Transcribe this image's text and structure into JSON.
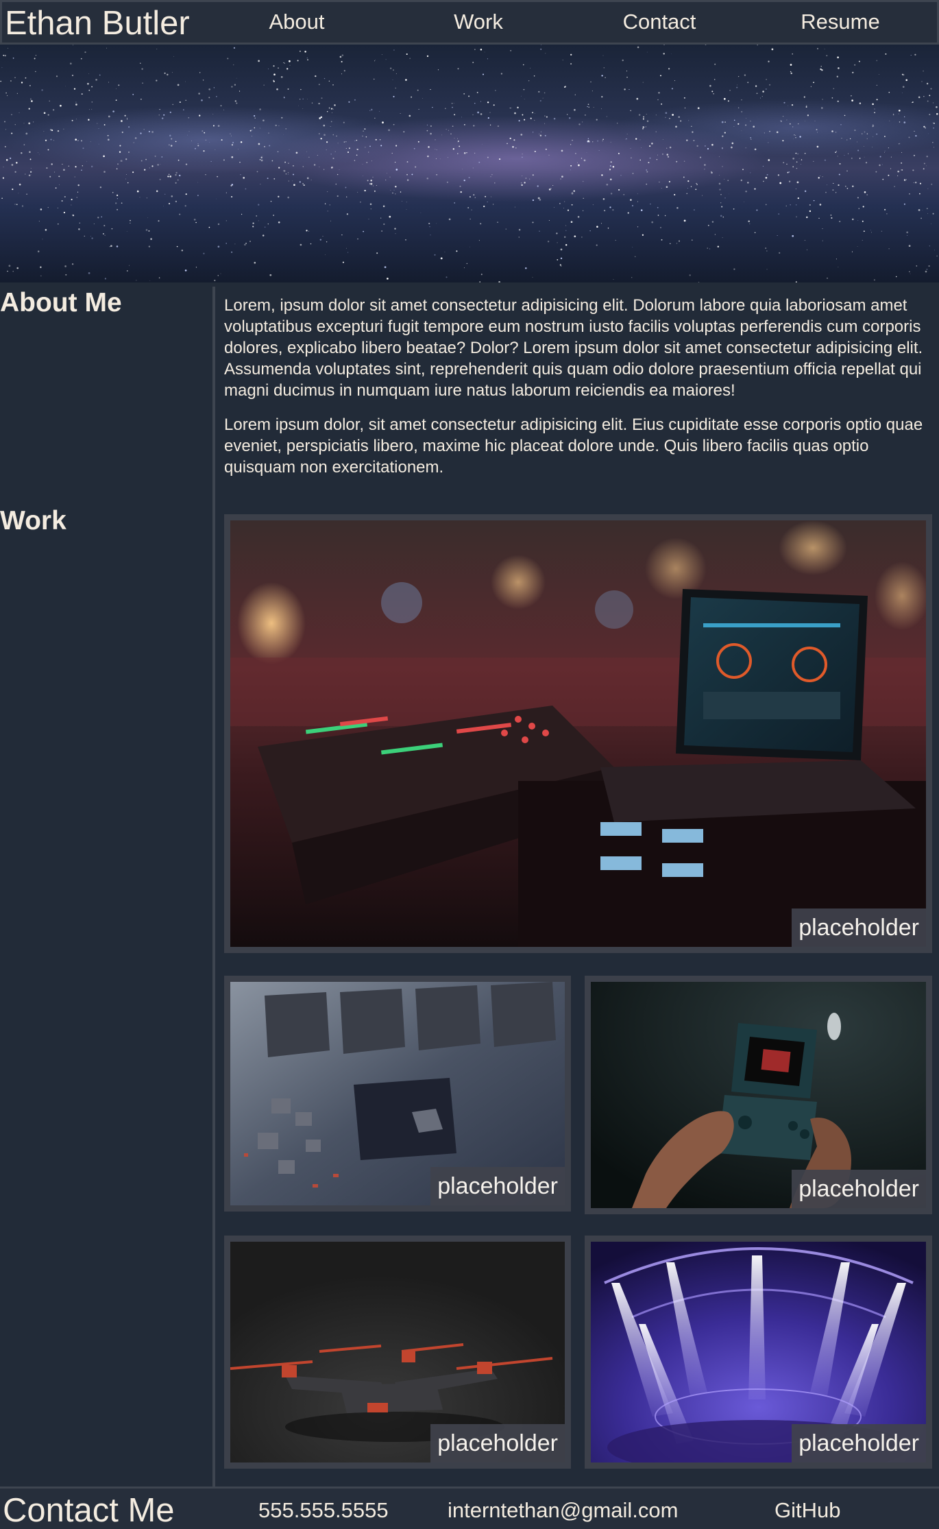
{
  "header": {
    "brand": "Ethan Butler",
    "nav": [
      "About",
      "Work",
      "Contact",
      "Resume"
    ]
  },
  "hero": {
    "image": "starry-sky-image"
  },
  "about": {
    "title": "About Me",
    "paragraphs": [
      "Lorem, ipsum dolor sit amet consectetur adipisicing elit. Dolorum labore quia laboriosam amet voluptatibus excepturi fugit tempore eum nostrum iusto facilis voluptas perferendis cum corporis dolores, explicabo libero beatae? Dolor? Lorem ipsum dolor sit amet consectetur adipisicing elit. Assumenda voluptates sint, reprehenderit quis quam odio dolore praesentium officia repellat qui magni ducimus in numquam iure natus laborum reiciendis ea maiores!",
      "Lorem ipsum dolor, sit amet consectetur adipisicing elit. Eius cupiditate esse corporis optio quae eveniet, perspiciatis libero, maxime hic placeat dolore unde. Quis libero facilis quas optio quisquam non exercitationem."
    ]
  },
  "work": {
    "title": "Work",
    "items": [
      {
        "caption": "placeholder",
        "image": "dj-mixer-laptop-image"
      },
      {
        "caption": "placeholder",
        "image": "circuit-board-image"
      },
      {
        "caption": "placeholder",
        "image": "handheld-console-image"
      },
      {
        "caption": "placeholder",
        "image": "drone-image"
      },
      {
        "caption": "placeholder",
        "image": "stage-lights-image"
      }
    ]
  },
  "footer": {
    "title": "Contact Me",
    "phone": "555.555.5555",
    "email": "interntethan@gmail.com",
    "github": "GitHub"
  },
  "colors": {
    "background": "#222b38",
    "header": "#262e3b",
    "border": "#3e4550",
    "text": "#f4ece0",
    "card": "#3c404a"
  }
}
